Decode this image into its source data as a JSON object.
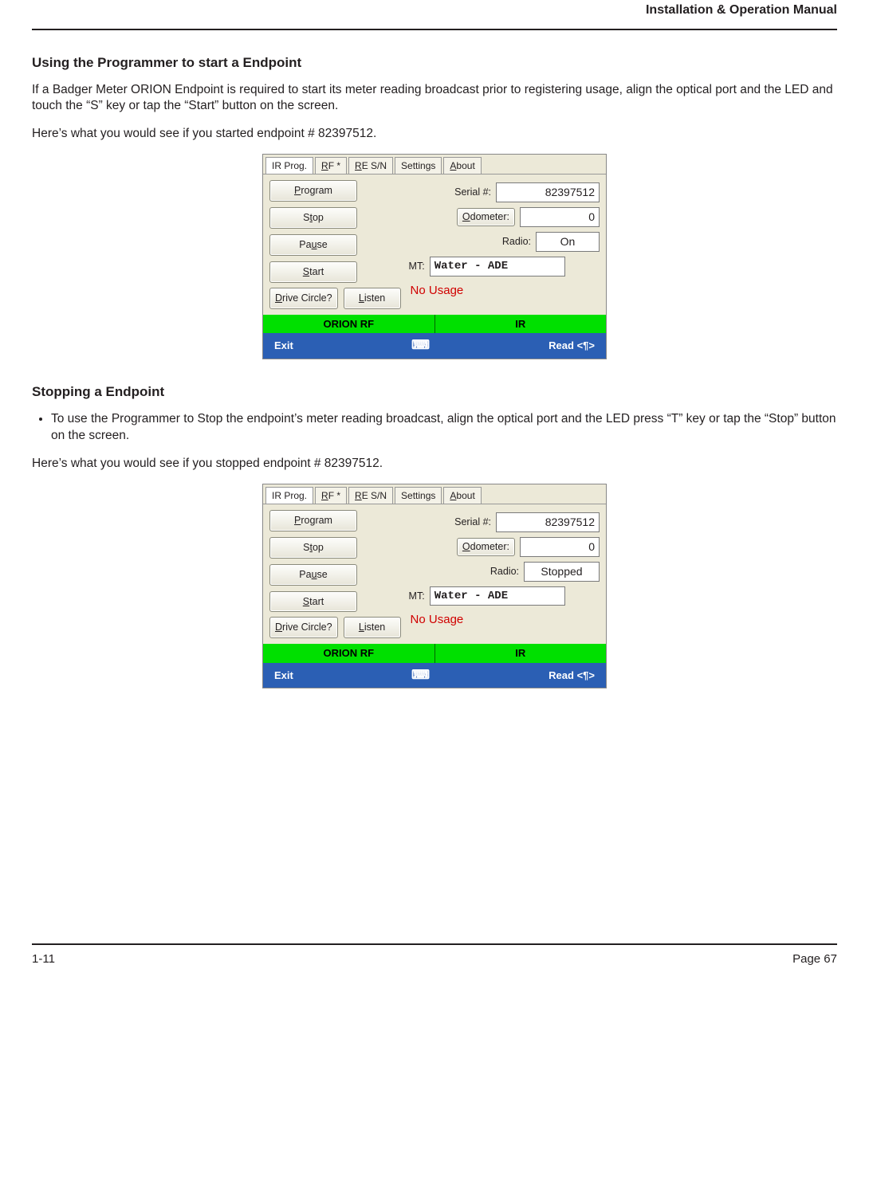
{
  "header": {
    "manual_title": "Installation & Operation Manual"
  },
  "sections": {
    "s1_title": "Using the Programmer to start a Endpoint",
    "s1_p1": "If a Badger Meter ORION Endpoint is required to start its meter reading broadcast prior to registering usage, align the optical port and the LED and touch the “S” key or tap the “Start” button on the screen.",
    "s1_p2": "Here’s what you would see if you started endpoint # 82397512.",
    "s2_title": "Stopping a Endpoint",
    "s2_b1": "To use the Programmer to Stop the endpoint’s meter reading broadcast, align the optical port and the LED press “T” key or tap the “Stop” button on the screen.",
    "s2_p2": "Here’s what you would see if you stopped endpoint # 82397512."
  },
  "shot_common": {
    "tabs": {
      "t0": "IR Prog.",
      "t1_pre": "R",
      "t1_mid": "F *",
      "t2_pre": "R",
      "t2_mid": "E S/N",
      "t3": "Settings",
      "t4_pre": "A",
      "t4_rest": "bout"
    },
    "btns": {
      "program_pre": "P",
      "program_rest": "rogram",
      "stop_pre": "S",
      "stop_mid": "t",
      "stop_rest": "op",
      "pause_pre": "Pa",
      "pause_mid": "u",
      "pause_rest": "se",
      "start_pre": "S",
      "start_rest": "tart",
      "drive_pre": "D",
      "drive_rest": "rive Circle?",
      "listen_pre": "L",
      "listen_rest": "isten"
    },
    "labels": {
      "serial": "Serial #:",
      "odometer_pre": "O",
      "odometer_rest": "dometer:",
      "radio": "Radio:",
      "mt": "MT:"
    },
    "status": {
      "nousage": "No Usage"
    },
    "greenbar": {
      "left": "ORION RF",
      "right": "IR"
    },
    "bluebar": {
      "exit": "Exit",
      "kbd": "⌨",
      "read": "Read <¶>"
    }
  },
  "shot1": {
    "serial": "82397512",
    "odometer": "0",
    "radio": "On",
    "mt": "Water - ADE"
  },
  "shot2": {
    "serial": "82397512",
    "odometer": "0",
    "radio": "Stopped",
    "mt": "Water - ADE"
  },
  "footer": {
    "left": "1-11",
    "right": "Page 67"
  }
}
